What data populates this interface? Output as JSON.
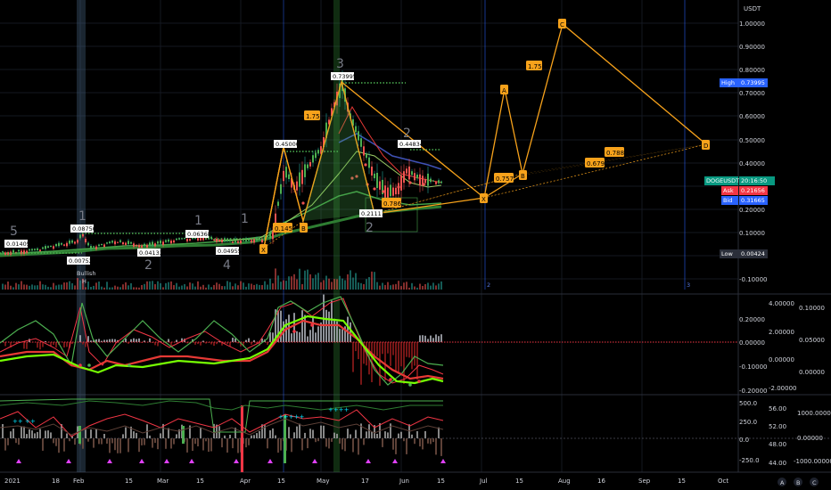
{
  "price_axis": {
    "currency": "USDT",
    "ticks": [
      "1.00000",
      "0.90000",
      "0.80000",
      "0.70000",
      "0.60000",
      "0.50000",
      "0.40000",
      "0.30000",
      "0.20000",
      "0.10000",
      "0.00000",
      "-0.10000"
    ],
    "high_label": "High",
    "high_value": "0.73995",
    "low_label": "Low",
    "low_value": "0.00424",
    "symbol_label": "DOGEUSDT",
    "symbol_time": "20:16:50",
    "ask_label": "Ask",
    "ask_value": "0.21656",
    "bid_label": "Bid",
    "bid_value": "0.31665",
    "colors": {
      "high": "#2962ff",
      "low": "#2a2e39",
      "symbol": "#089981",
      "ask": "#f23645",
      "bid": "#2962ff"
    }
  },
  "macd_axis_left": [
    "0.10000",
    "0.00000",
    "-0.10000",
    "-0.20000"
  ],
  "macd_axis_left_top": [
    "0.20000"
  ],
  "macd_axis_mid": [
    "4.00000",
    "2.00000",
    "0.00000",
    "-2.00000"
  ],
  "macd_axis_right": [
    "0.10000",
    "0.05000",
    "0.00000"
  ],
  "osc_axis_left": [
    "500.0",
    "250.0",
    "0.0",
    "-250.0"
  ],
  "osc_axis_mid": [
    "56.00",
    "52.00",
    "48.00",
    "44.00"
  ],
  "osc_axis_right": [
    "1000.00000",
    "0.00000",
    "-1000.00000"
  ],
  "time_axis": [
    "2021",
    "18",
    "Feb",
    "15",
    "Mar",
    "15",
    "Apr",
    "15",
    "May",
    "17",
    "Jun",
    "15",
    "Jul",
    "15",
    "Aug",
    "16",
    "Sep",
    "15",
    "Oct"
  ],
  "bottom_buttons": [
    "A",
    "B",
    "C"
  ],
  "price_labels": [
    "0.01405",
    "0.08750",
    "0.00752",
    "0.04133",
    "0.06368",
    "0.04955",
    "0.45000",
    "0.73995",
    "0.44834",
    "0.21111"
  ],
  "bullish_label": "Bullish",
  "bullish_sub": "H",
  "wave_labels": [
    "5",
    "1",
    "2",
    "1",
    "2",
    "4",
    "1",
    "3",
    "2"
  ],
  "pattern_points": [
    "X",
    "A",
    "B",
    "C",
    "D"
  ],
  "pattern_small": [
    "X",
    "B"
  ],
  "ratio_labels": [
    "1.75",
    "0.145",
    "0.786",
    "1.75",
    "0.757",
    "0.679",
    "0.788"
  ],
  "cycle_labels": [
    "2",
    "3"
  ],
  "brand_colors": {
    "accent": "#f7a21b",
    "up": "#4caf50",
    "down": "#f23645",
    "grid": "#1e222d"
  }
}
